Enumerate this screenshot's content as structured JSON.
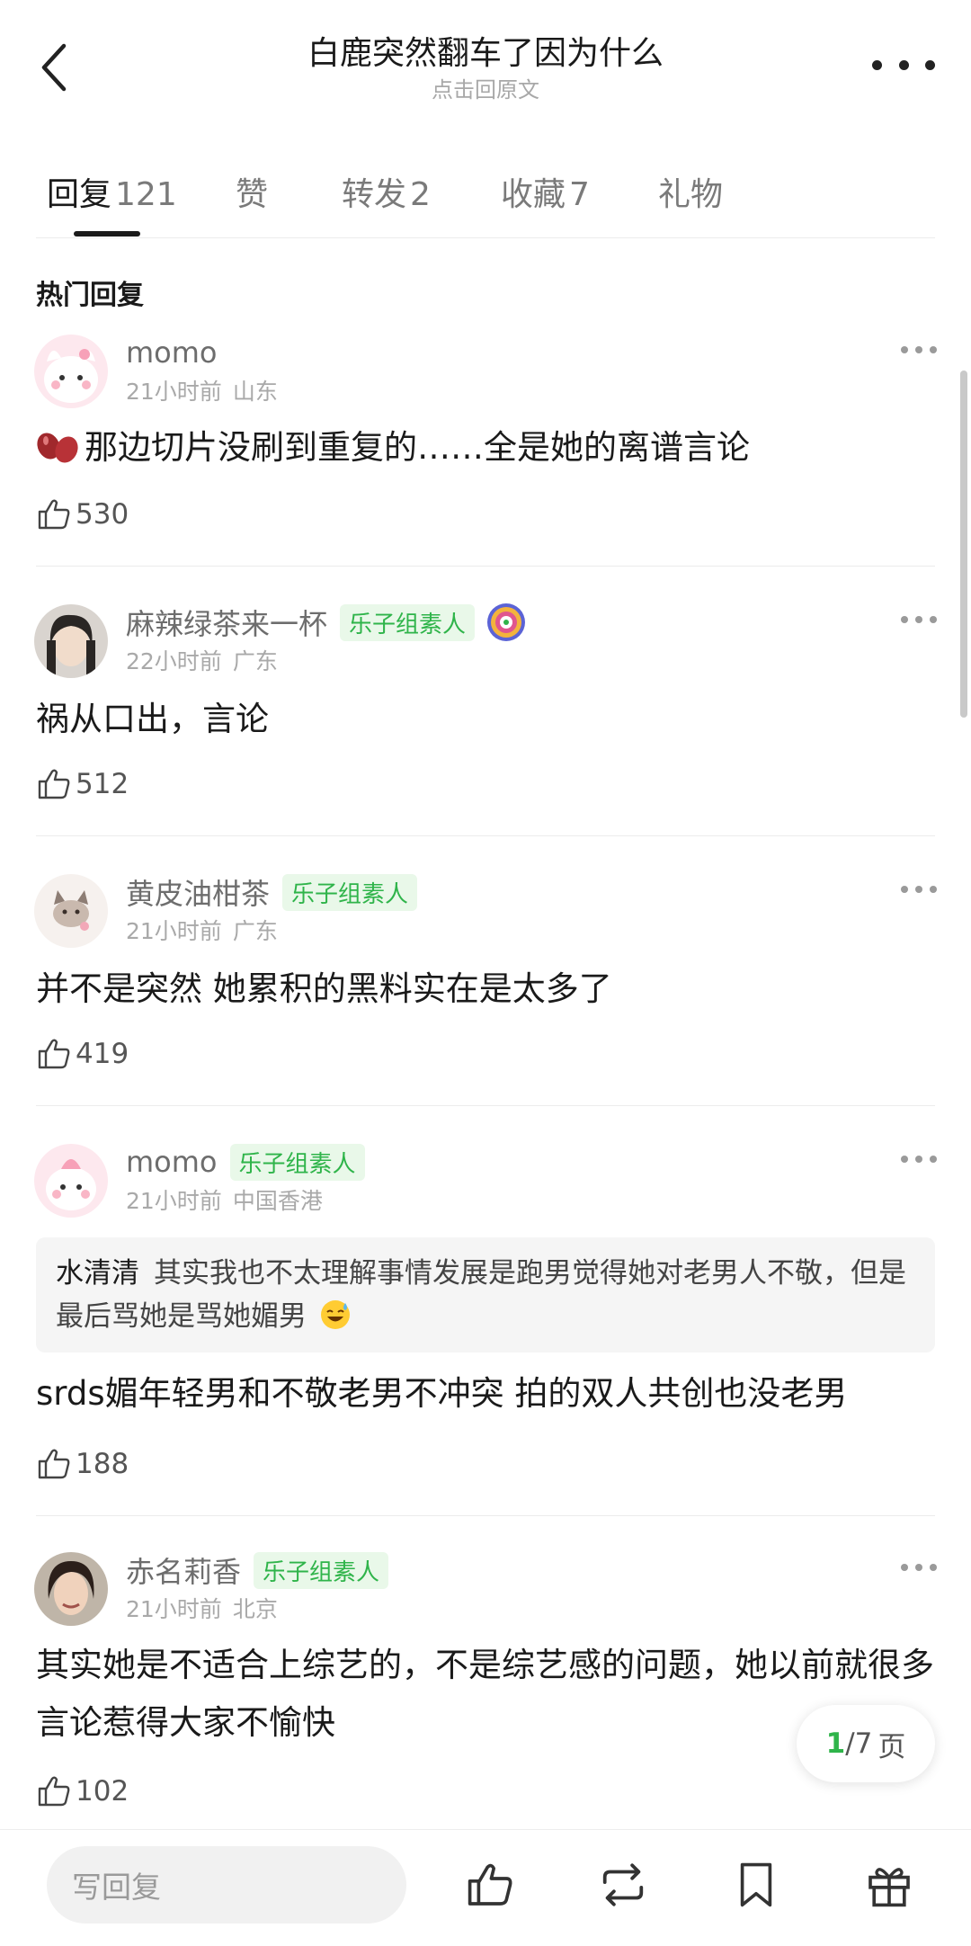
{
  "header": {
    "title": "白鹿突然翻车了因为什么",
    "subtitle": "点击回原文"
  },
  "tabs": [
    {
      "label": "回复",
      "count": "121"
    },
    {
      "label": "赞",
      "count": ""
    },
    {
      "label": "转发",
      "count": "2"
    },
    {
      "label": "收藏",
      "count": "7"
    },
    {
      "label": "礼物",
      "count": ""
    }
  ],
  "section_title": "热门回复",
  "comments": [
    {
      "name": "momo",
      "badge": "",
      "time": "21小时前",
      "location": "山东",
      "text": "那边切片没刷到重复的……全是她的离谱言论",
      "likes": "530"
    },
    {
      "name": "麻辣绿茶来一杯",
      "badge": "乐子组素人",
      "time": "22小时前",
      "location": "广东",
      "text": "祸从口出，言论",
      "likes": "512"
    },
    {
      "name": "黄皮油柑茶",
      "badge": "乐子组素人",
      "time": "21小时前",
      "location": "广东",
      "text": "并不是突然 她累积的黑料实在是太多了",
      "likes": "419"
    },
    {
      "name": "momo",
      "badge": "乐子组素人",
      "time": "21小时前",
      "location": "中国香港",
      "quote_name": "水清清",
      "quote_text": "其实我也不太理解事情发展是跑男觉得她对老男人不敬，但是最后骂她是骂她媚男",
      "text": "srds媚年轻男和不敬老男不冲突 拍的双人共创也没老男",
      "likes": "188"
    },
    {
      "name": "赤名莉香",
      "badge": "乐子组素人",
      "time": "21小时前",
      "location": "北京",
      "text": "其实她是不适合上综艺的，不是综艺感的问题，她以前就很多言论惹得大家不愉快",
      "likes": "102"
    }
  ],
  "pagination": {
    "current": "1",
    "total": "/7",
    "unit": "页"
  },
  "bottom_bar": {
    "reply_placeholder": "写回复"
  },
  "colors": {
    "accent_green": "#2fb44a",
    "badge_bg": "#e9f8e9",
    "text_gray": "#a9a9a9"
  }
}
